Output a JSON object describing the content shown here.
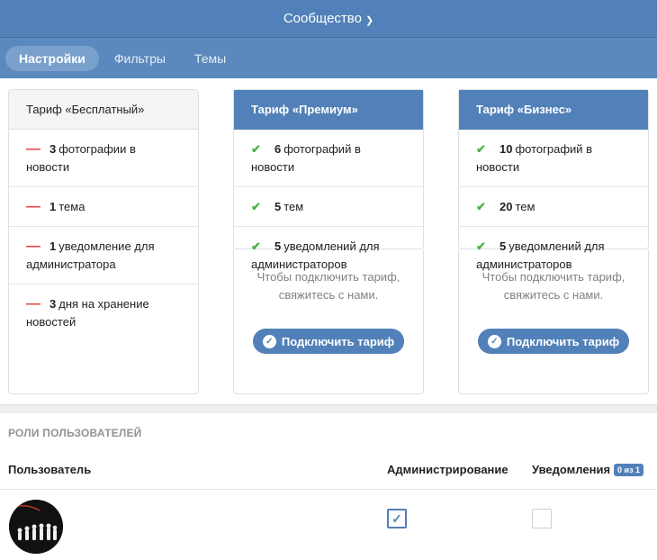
{
  "header": {
    "title": "Сообщество"
  },
  "tabs": [
    {
      "label": "Настройки",
      "active": true
    },
    {
      "label": "Фильтры",
      "active": false
    },
    {
      "label": "Темы",
      "active": false
    }
  ],
  "plans": {
    "free": {
      "title": "Тариф «Бесплатный»",
      "features": [
        {
          "num": "3",
          "text": "фотографии в новости"
        },
        {
          "num": "1",
          "text": "тема"
        },
        {
          "num": "1",
          "text": "уведомление для администратора"
        },
        {
          "num": "3",
          "text": "дня на хранение новостей"
        }
      ]
    },
    "premium": {
      "title": "Тариф «Премиум»",
      "features": [
        {
          "num": "6",
          "text": "фотографий в новости"
        },
        {
          "num": "5",
          "text": "тем"
        },
        {
          "num": "5",
          "text": "уведомлений для администраторов"
        }
      ],
      "contact": "Чтобы подключить тариф, свяжитесь с нами.",
      "button": "Подключить тариф"
    },
    "business": {
      "title": "Тариф «Бизнес»",
      "features": [
        {
          "num": "10",
          "text": "фотографий в новости"
        },
        {
          "num": "20",
          "text": "тем"
        },
        {
          "num": "5",
          "text": "уведомлений для администраторов"
        }
      ],
      "contact": "Чтобы подключить тариф, свяжитесь с нами.",
      "button": "Подключить тариф"
    }
  },
  "roles": {
    "title": "РОЛИ ПОЛЬЗОВАТЕЛЕЙ",
    "col_user": "Пользователь",
    "col_admin": "Администрирование",
    "col_notif": "Уведомления",
    "notif_badge": "0 из 1",
    "rows": [
      {
        "admin": true,
        "notif": false
      }
    ]
  },
  "colors": {
    "accent": "#5181b8",
    "check": "#4bb34b",
    "minus": "#e64646"
  }
}
